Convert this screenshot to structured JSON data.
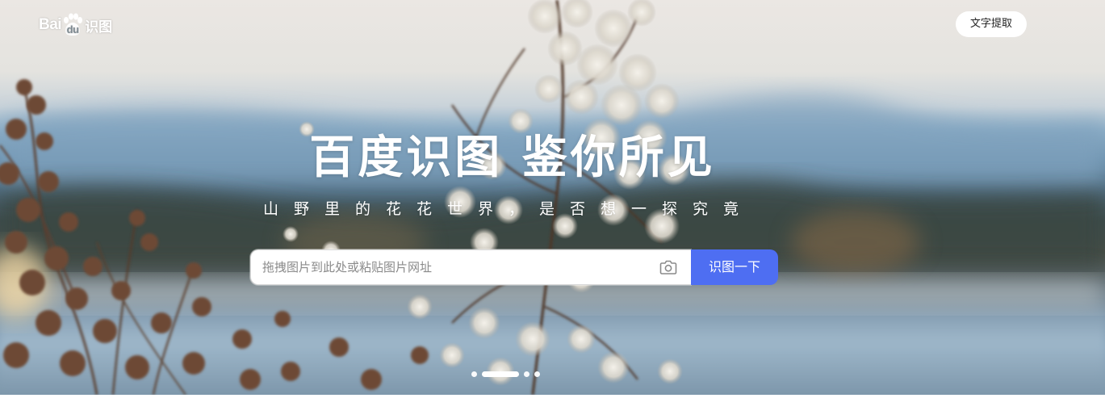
{
  "logo": {
    "bai": "Bai",
    "du": "du",
    "product": "识图"
  },
  "header": {
    "text_extract_label": "文字提取"
  },
  "hero": {
    "title": "百度识图 鉴你所见",
    "subtitle": "山野里的花花世界，是否想一探究竟"
  },
  "search": {
    "placeholder": "拖拽图片到此处或粘贴图片网址",
    "value": "",
    "button_label": "识图一下",
    "camera_icon": "camera-icon"
  },
  "carousel": {
    "slide_count": 4,
    "active_index": 1
  },
  "colors": {
    "accent": "#4e6ef2",
    "button_bg": "#ffffff",
    "text_on_hero": "#ffffff"
  }
}
